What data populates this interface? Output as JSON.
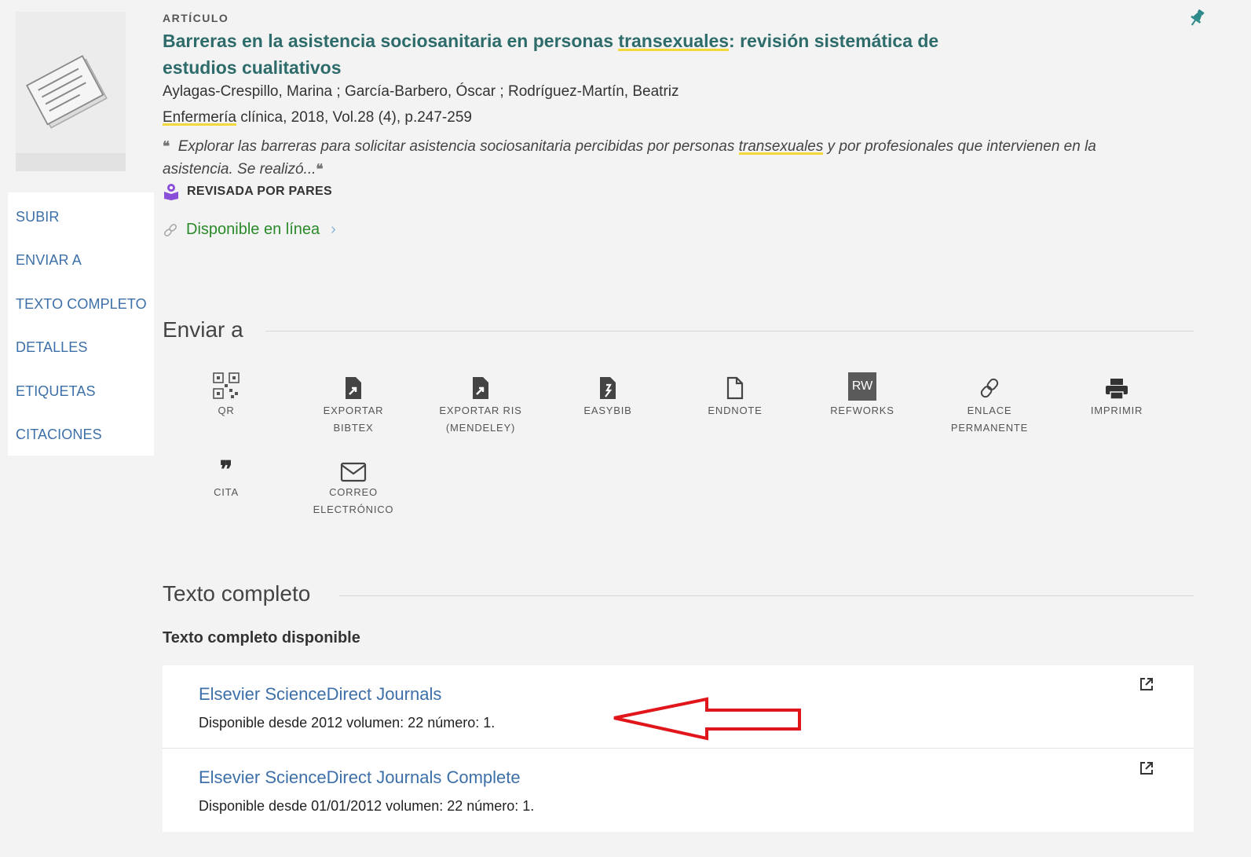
{
  "record": {
    "type_label": "ARTÍCULO",
    "title_part1": "Barreras en la asistencia sociosanitaria en personas ",
    "title_highlight": "transexuales",
    "title_part2": ": revisión sistemática de estudios cualitativos",
    "authors": "Aylagas-Crespillo, Marina ; García-Barbero, Óscar ; Rodríguez-Martín, Beatriz",
    "source_highlight": "Enfermería",
    "source_rest": " clínica, 2018, Vol.28 (4), p.247-259",
    "snippet_part1": "Explorar las barreras para solicitar asistencia sociosanitaria percibidas por personas ",
    "snippet_highlight": "transexuales",
    "snippet_part2": " y por profesionales que intervienen en la asistencia. Se realizó...",
    "peer_reviewed": "REVISADA POR PARES",
    "availability": "Disponible en línea"
  },
  "sidebar": {
    "items": [
      "SUBIR",
      "ENVIAR A",
      "TEXTO COMPLETO",
      "DETALLES",
      "ETIQUETAS",
      "CITACIONES"
    ]
  },
  "send_to": {
    "title": "Enviar a",
    "actions": [
      {
        "label1": "QR",
        "label2": "",
        "icon": "qr-code-icon"
      },
      {
        "label1": "EXPORTAR",
        "label2": "BIBTEX",
        "icon": "export-file-icon"
      },
      {
        "label1": "EXPORTAR RIS",
        "label2": "(MENDELEY)",
        "icon": "export-file-icon"
      },
      {
        "label1": "EASYBIB",
        "label2": "",
        "icon": "easybib-icon"
      },
      {
        "label1": "ENDNOTE",
        "label2": "",
        "icon": "document-icon"
      },
      {
        "label1": "REFWORKS",
        "label2": "",
        "icon": "refworks-icon",
        "badge": "RW"
      },
      {
        "label1": "ENLACE",
        "label2": "PERMANENTE",
        "icon": "link-icon"
      },
      {
        "label1": "IMPRIMIR",
        "label2": "",
        "icon": "printer-icon"
      },
      {
        "label1": "CITA",
        "label2": "",
        "icon": "quote-icon"
      },
      {
        "label1": "CORREO",
        "label2": "ELECTRÓNICO",
        "icon": "mail-icon"
      }
    ]
  },
  "full_text": {
    "title": "Texto completo",
    "subtitle": "Texto completo disponible",
    "sources": [
      {
        "name": "Elsevier ScienceDirect Journals",
        "info": "Disponible desde 2012 volumen: 22 número: 1."
      },
      {
        "name": "Elsevier ScienceDirect Journals Complete",
        "info": "Disponible desde 01/01/2012 volumen: 22 número: 1."
      }
    ]
  },
  "colors": {
    "title": "#2e6b6b",
    "link": "#3d6fa8",
    "available": "#2a8a2a",
    "highlight": "#f3d83b",
    "annotation_arrow": "#e0161b"
  }
}
